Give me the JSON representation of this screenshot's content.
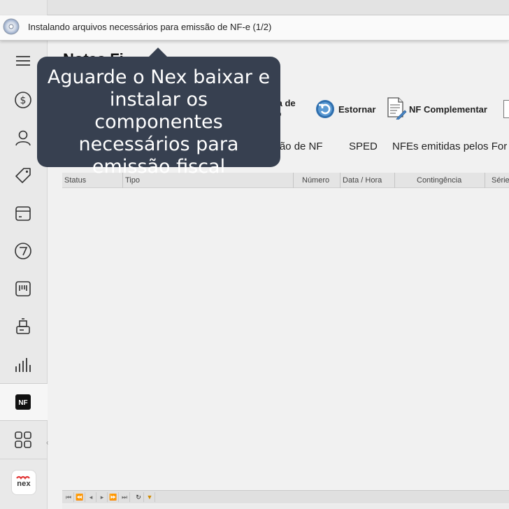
{
  "notification": {
    "message": "Instalando arquivos necessários para emissão de NF-e (1/2)"
  },
  "page": {
    "title": "Notas Fi"
  },
  "tooltip": {
    "text": "Aguarde o Nex baixar e instalar os componentes necessários para emissão fiscal"
  },
  "toolbar": {
    "carta_label": "arta de\nção",
    "estornar_label": "Estornar",
    "nf_complementar_label": "NF Complementar"
  },
  "tabs": [
    {
      "label": "ação de NF"
    },
    {
      "label": "SPED"
    },
    {
      "label": "NFEs emitidas pelos For"
    }
  ],
  "table": {
    "columns": [
      "Status",
      "Tipo",
      "Número",
      "Data / Hora",
      "Contingência",
      "Série"
    ]
  },
  "sidebar": {
    "items": [
      {
        "icon": "menu-icon"
      },
      {
        "icon": "dollar-icon"
      },
      {
        "icon": "user-icon"
      },
      {
        "icon": "tag-icon"
      },
      {
        "icon": "box-icon"
      },
      {
        "icon": "dashboard-icon"
      },
      {
        "icon": "barcode-icon"
      },
      {
        "icon": "register-icon"
      },
      {
        "icon": "chart-icon"
      },
      {
        "icon": "nf-icon",
        "label": "NF",
        "active": true
      },
      {
        "icon": "apps-grid-icon"
      }
    ],
    "logo": "nex"
  },
  "colors": {
    "tooltip_bg": "#374050",
    "estornar_icon": "#2f6fae",
    "brand_red": "#e23b3b"
  }
}
